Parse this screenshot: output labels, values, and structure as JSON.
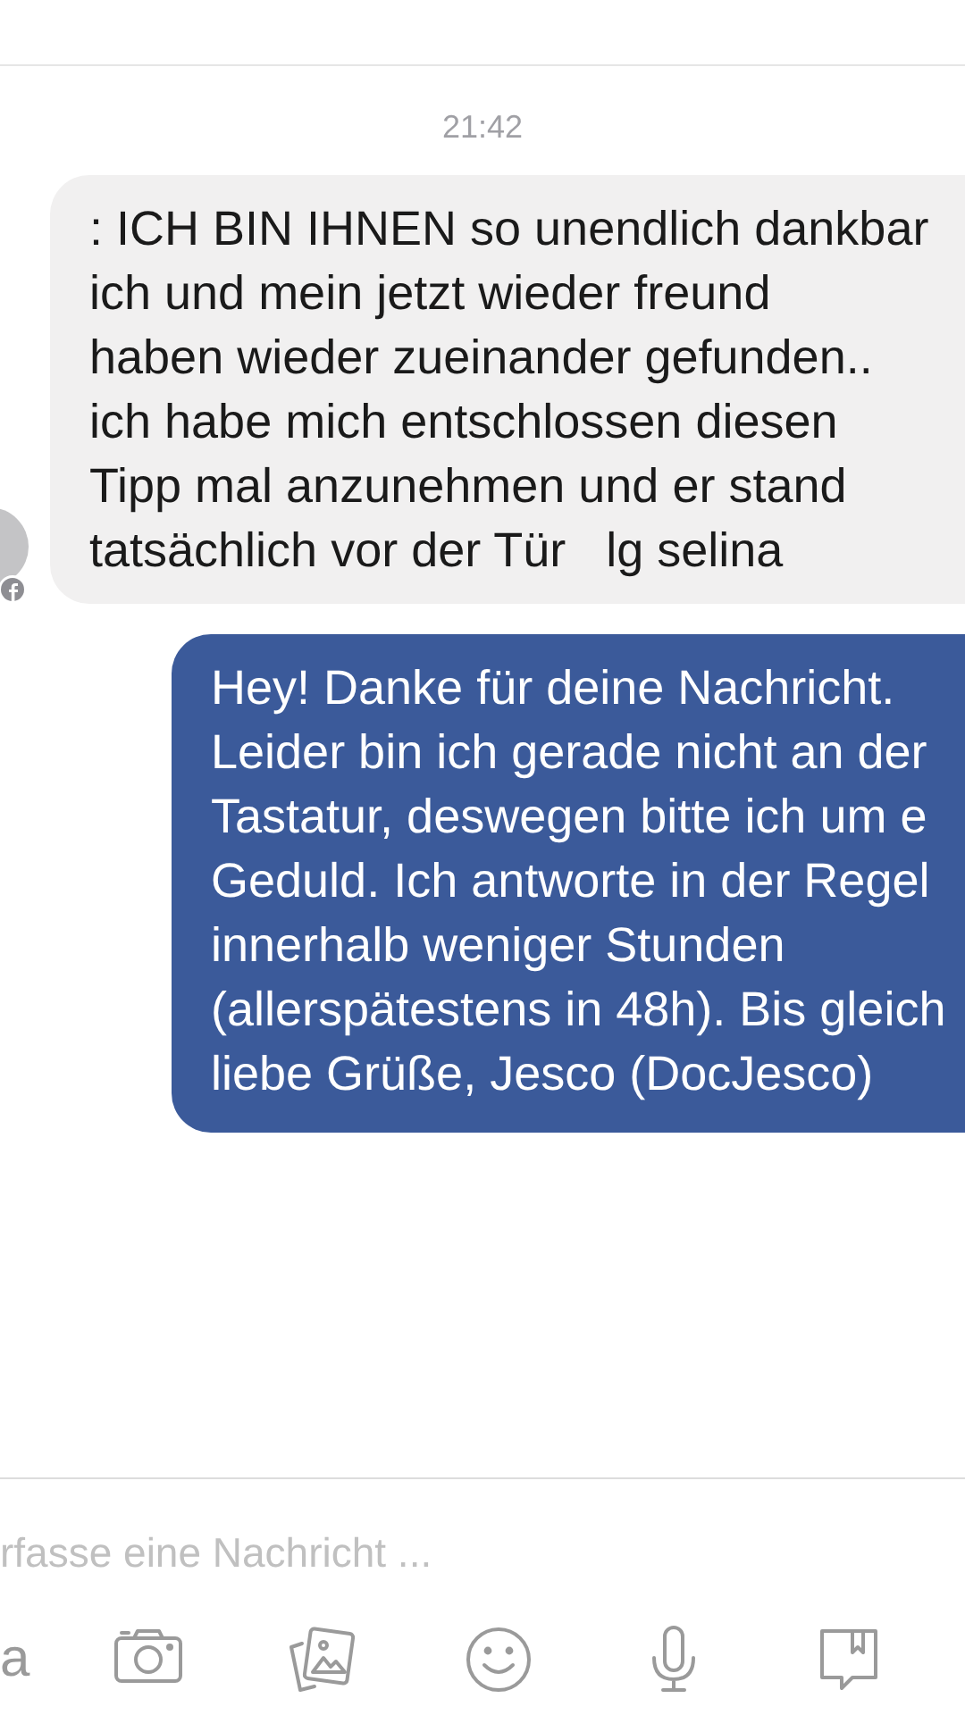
{
  "timestamp": "21:42",
  "messages": [
    {
      "kind": "incoming",
      "lines": [
        ": ICH BIN IHNEN so unendlich dankbar",
        "ich und mein jetzt wieder freund",
        "haben wieder zueinander gefunden..",
        "ich habe mich entschlossen diesen",
        "Tipp mal anzunehmen und er stand",
        "tatsächlich vor der Tür   lg selina"
      ]
    },
    {
      "kind": "outgoing",
      "lines": [
        "Hey! Danke für deine Nachricht.",
        "Leider bin ich gerade nicht an der",
        "Tastatur, deswegen bitte ich um e",
        "Geduld. Ich antworte in der Regel",
        "innerhalb weniger Stunden",
        "(allerspätestens in 48h). Bis gleich",
        "liebe Grüße, Jesco (DocJesco)"
      ]
    }
  ],
  "composer": {
    "placeholder": "rfasse eine Nachricht ..."
  },
  "toolbar": [
    {
      "kind": "text",
      "label": "a"
    },
    {
      "kind": "camera"
    },
    {
      "kind": "gallery"
    },
    {
      "kind": "emoji"
    },
    {
      "kind": "mic"
    },
    {
      "kind": "sticker"
    }
  ]
}
